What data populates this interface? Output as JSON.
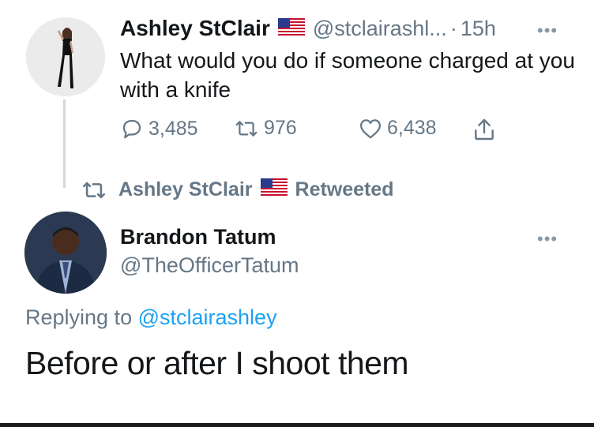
{
  "original_tweet": {
    "display_name": "Ashley StClair",
    "flag_icon": "us-flag-icon",
    "handle": "@stclairashl...",
    "separator": "·",
    "time": "15h",
    "more_icon": "more-horizontal-icon",
    "text": "What would you do if someone charged at you with a knife",
    "actions": {
      "reply_count": "3,485",
      "retweet_count": "976",
      "like_count": "6,438"
    }
  },
  "retweet_banner": {
    "retweeter": "Ashley StClair",
    "label": "Retweeted"
  },
  "reply_tweet": {
    "display_name": "Brandon Tatum",
    "handle": "@TheOfficerTatum",
    "replying_prefix": "Replying to",
    "replying_to": "@stclairashley",
    "text": "Before or after I shoot them"
  },
  "colors": {
    "primary_text": "#14171a",
    "secondary_text": "#657786",
    "link": "#1da1f2",
    "divider": "#cfd9de"
  }
}
